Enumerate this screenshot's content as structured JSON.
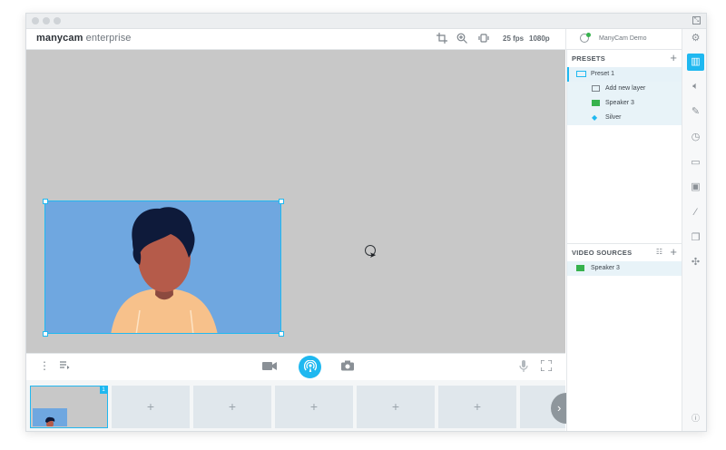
{
  "app": {
    "logo_main": "manycam",
    "logo_sub": " enterprise",
    "fps": "25 fps",
    "resolution": "1080p",
    "user_name": "ManyCam Demo"
  },
  "icons": {
    "crop": "crop-icon",
    "zoom": "zoom-in-icon",
    "effects": "effects-icon",
    "user": "user-icon",
    "settings": "gear-icon"
  },
  "presets": {
    "title": "PRESETS",
    "items": [
      {
        "label": "Preset 1"
      },
      {
        "label": "Add new layer"
      },
      {
        "label": "Speaker 3"
      },
      {
        "label": "Silver"
      }
    ]
  },
  "video_sources": {
    "title": "VIDEO SOURCES",
    "items": [
      {
        "label": "Speaker 3"
      }
    ]
  },
  "strip": {
    "active_badge": "1",
    "add_label": "+"
  },
  "colors": {
    "accent": "#1fb8f0",
    "canvas_bg": "#c8c8c8",
    "video_bg": "#6fa7e0",
    "green": "#37b24d"
  }
}
